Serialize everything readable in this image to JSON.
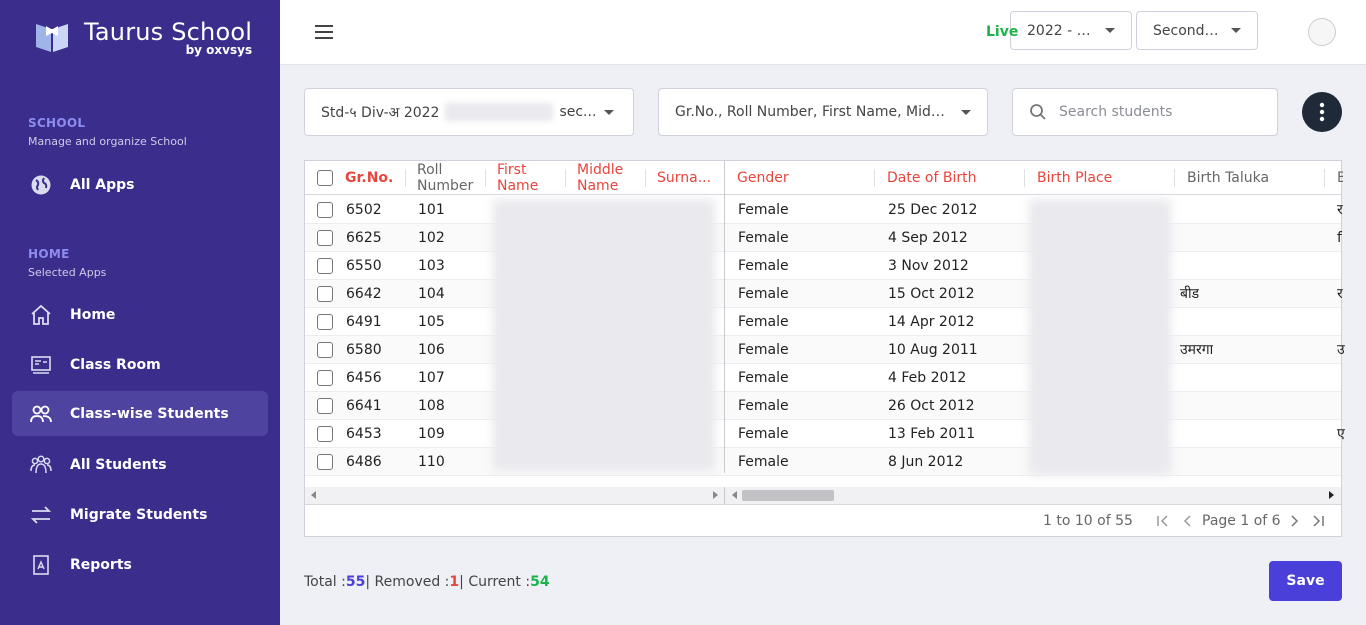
{
  "brand": {
    "name": "Taurus School",
    "by": "by oxvsys"
  },
  "sidebar": {
    "school": {
      "title": "SCHOOL",
      "subtitle": "Manage and organize School"
    },
    "all_apps": "All Apps",
    "home_section": {
      "title": "HOME",
      "subtitle": "Selected Apps"
    },
    "items": [
      {
        "label": "Home",
        "icon": "home-icon"
      },
      {
        "label": "Class Room",
        "icon": "classroom-icon"
      },
      {
        "label": "Class-wise Students",
        "icon": "users-icon",
        "active": true
      },
      {
        "label": "All Students",
        "icon": "group-icon"
      },
      {
        "label": "Migrate Students",
        "icon": "swap-icon"
      },
      {
        "label": "Reports",
        "icon": "report-icon"
      }
    ]
  },
  "topbar": {
    "year": "2022 - 2...",
    "section": "Seconda...",
    "live": "Live"
  },
  "filters": {
    "class": "Std-५ Div-अ 2022",
    "class_suffix": "sec...",
    "columns": "Gr.No., Roll Number, First Name, Middle ...",
    "search_placeholder": "Search students"
  },
  "table": {
    "headers": {
      "grno": "Gr.No.",
      "roll": "Roll Number",
      "first": "First Name",
      "middle": "Middle Name",
      "surname": "Surna...",
      "gender": "Gender",
      "dob": "Date of Birth",
      "birth_place": "Birth Place",
      "taluka": "Birth Taluka",
      "extra": "B"
    },
    "rows": [
      {
        "grno": "6502",
        "roll": "101",
        "gender": "Female",
        "dob": "25 Dec 2012",
        "taluka": "",
        "extra": "र"
      },
      {
        "grno": "6625",
        "roll": "102",
        "gender": "Female",
        "dob": "4 Sep 2012",
        "taluka": "",
        "extra": "f"
      },
      {
        "grno": "6550",
        "roll": "103",
        "gender": "Female",
        "dob": "3 Nov 2012",
        "taluka": "",
        "extra": ""
      },
      {
        "grno": "6642",
        "roll": "104",
        "gender": "Female",
        "dob": "15 Oct 2012",
        "taluka": "बीड",
        "extra": "र"
      },
      {
        "grno": "6491",
        "roll": "105",
        "gender": "Female",
        "dob": "14 Apr 2012",
        "taluka": "",
        "extra": ""
      },
      {
        "grno": "6580",
        "roll": "106",
        "gender": "Female",
        "dob": "10 Aug 2011",
        "taluka": "उमरगा",
        "extra": "उ"
      },
      {
        "grno": "6456",
        "roll": "107",
        "gender": "Female",
        "dob": "4 Feb 2012",
        "taluka": "",
        "extra": ""
      },
      {
        "grno": "6641",
        "roll": "108",
        "gender": "Female",
        "dob": "26 Oct 2012",
        "taluka": "",
        "extra": ""
      },
      {
        "grno": "6453",
        "roll": "109",
        "gender": "Female",
        "dob": "13 Feb 2011",
        "taluka": "",
        "extra": "ए"
      },
      {
        "grno": "6486",
        "roll": "110",
        "gender": "Female",
        "dob": "8 Jun 2012",
        "taluka": "",
        "extra": ""
      }
    ]
  },
  "pager": {
    "range": "1 to 10 of 55",
    "page": "Page 1 of 6"
  },
  "footer": {
    "total_label": "Total :",
    "total": "55",
    "removed_label": "| Removed :",
    "removed": "1",
    "current_label": "| Current :",
    "current": "54",
    "save": "Save"
  }
}
